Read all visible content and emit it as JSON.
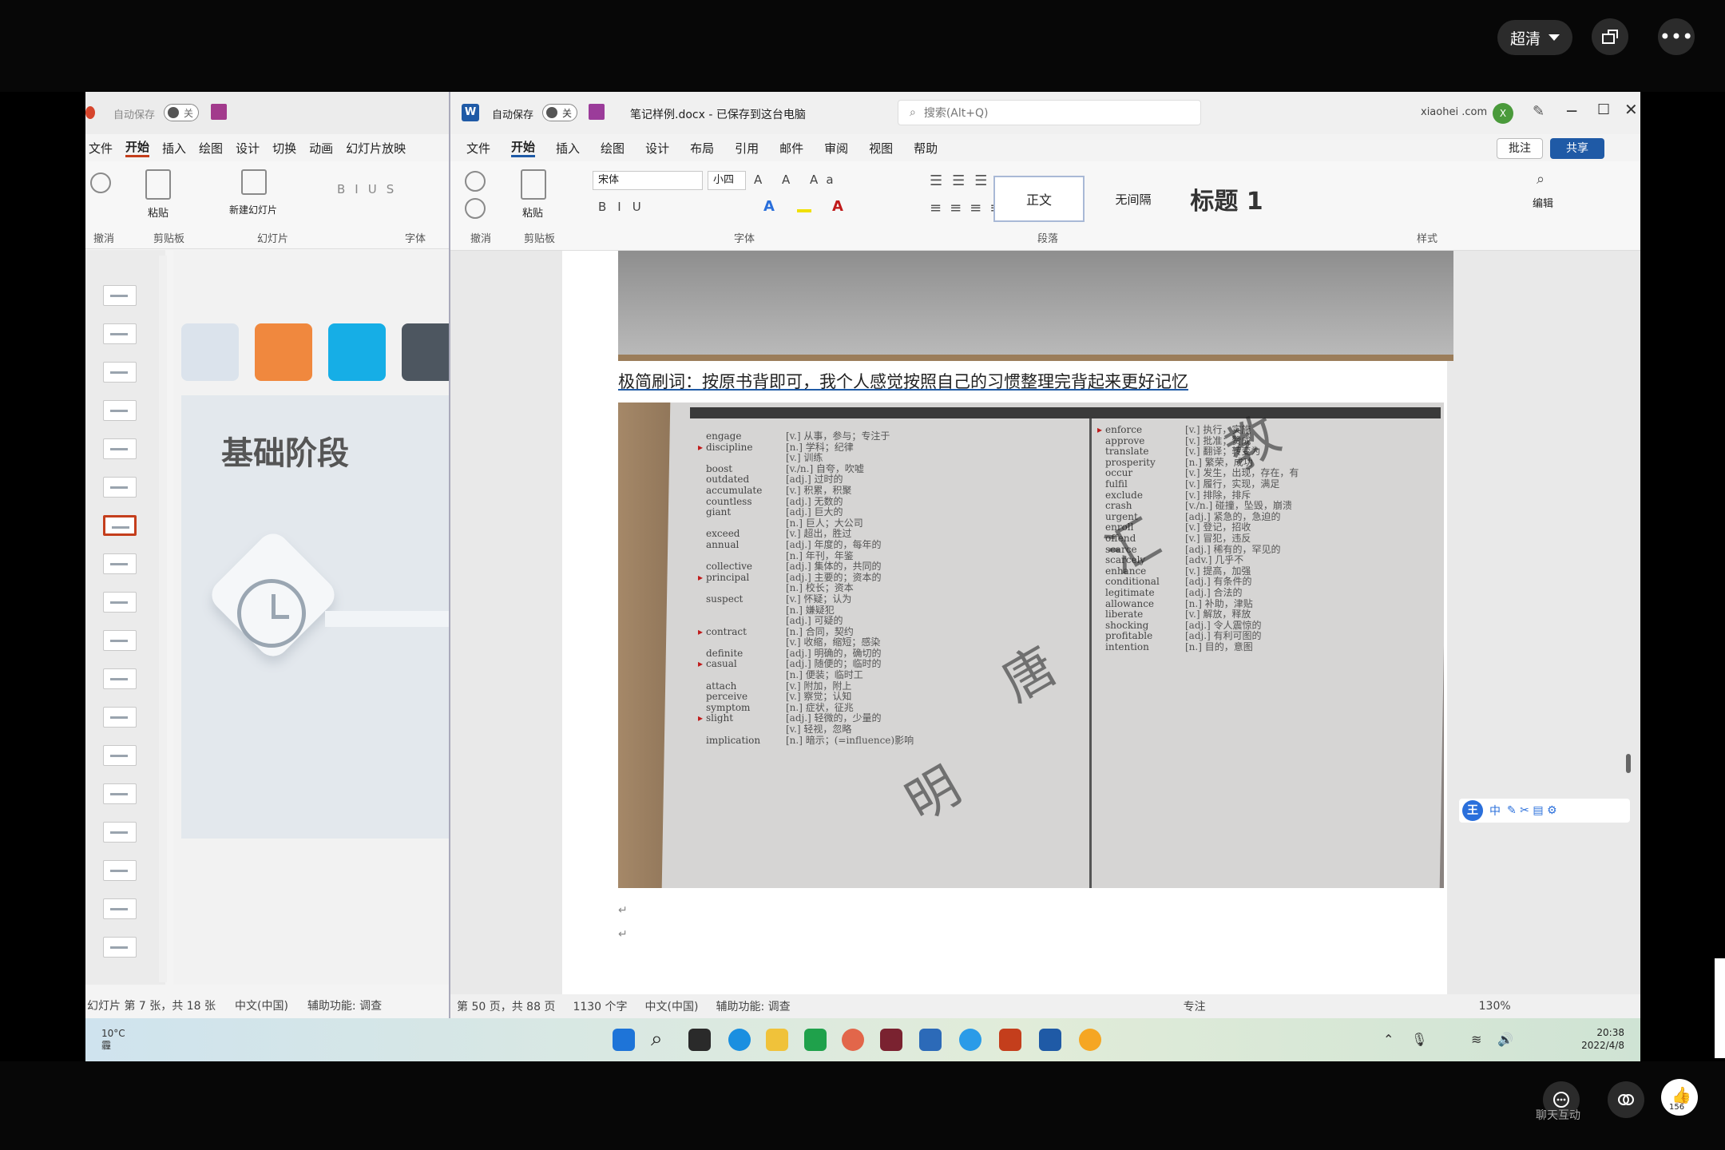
{
  "player": {
    "quality_label": "超清",
    "chat_label": "聊天互动",
    "like_count": "156"
  },
  "ppt": {
    "autosave_label": "自动保存",
    "autosave_state": "关",
    "menu": [
      "文件",
      "开始",
      "插入",
      "绘图",
      "设计",
      "切换",
      "动画",
      "幻灯片放映"
    ],
    "ribbon_groups": [
      "撤消",
      "剪贴板",
      "幻灯片",
      "字体"
    ],
    "paste_label": "粘贴",
    "new_slide_label": "新建幻灯片",
    "slide_title": "基础阶段",
    "status_slide": "幻灯片 第 7 张，共 18 张",
    "status_lang": "中文(中国)",
    "status_access": "辅助功能: 调查",
    "swatch_colors": [
      "#dbe3ec",
      "#f0883e",
      "#16aee6",
      "#4d5660"
    ]
  },
  "word": {
    "autosave_label": "自动保存",
    "autosave_state": "关",
    "doc_title": "笔记样例.docx - 已保存到这台电脑",
    "search_placeholder": "搜索(Alt+Q)",
    "account": "xiaohei .com",
    "account_initial": "X",
    "menu": [
      "文件",
      "开始",
      "插入",
      "绘图",
      "设计",
      "布局",
      "引用",
      "邮件",
      "审阅",
      "视图",
      "帮助"
    ],
    "comment_label": "批注",
    "share_label": "共享",
    "font_name": "宋体",
    "font_size": "小四",
    "ribbon_groups": [
      "撤消",
      "剪贴板",
      "字体",
      "段落",
      "样式"
    ],
    "paste_label": "粘贴",
    "styles": [
      "正文",
      "无间隔",
      "标题 1"
    ],
    "edit_label": "编辑",
    "doc_text": "极简刷词：按原书背即可，我个人感觉按照自己的习惯整理完背起来更好记忆",
    "status_page": "第 50 页，共 88 页",
    "status_words": "1130 个字",
    "status_lang": "中文(中国)",
    "status_access": "辅助功能: 调查",
    "status_focus": "专注",
    "zoom": "130%"
  },
  "vocab_left": [
    {
      "w": "engage",
      "d": "[v.] 从事，参与；专注于",
      "m": false
    },
    {
      "w": "discipline",
      "d": "[n.] 学科；纪律",
      "m": true
    },
    {
      "w": "",
      "d": "[v.] 训练",
      "m": false
    },
    {
      "w": "boost",
      "d": "[v./n.] 自夸，吹嘘",
      "m": false
    },
    {
      "w": "outdated",
      "d": "[adj.] 过时的",
      "m": false
    },
    {
      "w": "accumulate",
      "d": "[v.] 积累，积聚",
      "m": false
    },
    {
      "w": "countless",
      "d": "[adj.] 无数的",
      "m": false
    },
    {
      "w": "giant",
      "d": "[adj.] 巨大的",
      "m": false
    },
    {
      "w": "",
      "d": "[n.] 巨人；大公司",
      "m": false
    },
    {
      "w": "exceed",
      "d": "[v.] 超出，胜过",
      "m": false
    },
    {
      "w": "annual",
      "d": "[adj.] 年度的，每年的",
      "m": false
    },
    {
      "w": "",
      "d": "[n.] 年刊，年鉴",
      "m": false
    },
    {
      "w": "collective",
      "d": "[adj.] 集体的，共同的",
      "m": false
    },
    {
      "w": "principal",
      "d": "[adj.] 主要的；资本的",
      "m": true
    },
    {
      "w": "",
      "d": "[n.] 校长；资本",
      "m": false
    },
    {
      "w": "suspect",
      "d": "[v.] 怀疑；认为",
      "m": false
    },
    {
      "w": "",
      "d": "[n.] 嫌疑犯",
      "m": false
    },
    {
      "w": "",
      "d": "[adj.] 可疑的",
      "m": false
    },
    {
      "w": "contract",
      "d": "[n.] 合同，契约",
      "m": true
    },
    {
      "w": "",
      "d": "[v.] 收缩，缩短；感染",
      "m": false
    },
    {
      "w": "definite",
      "d": "[adj.] 明确的，确切的",
      "m": false
    },
    {
      "w": "casual",
      "d": "[adj.] 随便的；临时的",
      "m": true
    },
    {
      "w": "",
      "d": "[n.] 便装；临时工",
      "m": false
    },
    {
      "w": "attach",
      "d": "[v.] 附加，附上",
      "m": false
    },
    {
      "w": "perceive",
      "d": "[v.] 察觉；认知",
      "m": false
    },
    {
      "w": "symptom",
      "d": "[n.] 症状，征兆",
      "m": false
    },
    {
      "w": "slight",
      "d": "[adj.] 轻微的，少量的",
      "m": true
    },
    {
      "w": "",
      "d": "[v.] 轻视，忽略",
      "m": false
    },
    {
      "w": "implication",
      "d": "[n.] 暗示；(=influence)影响",
      "m": false
    }
  ],
  "vocab_right": [
    {
      "w": "enforce",
      "d": "[v.] 执行，实施",
      "m": true
    },
    {
      "w": "approve",
      "d": "[v.] 批准；赞成",
      "m": false
    },
    {
      "w": "translate",
      "d": "[v.] 翻译；转变为",
      "m": false
    },
    {
      "w": "prosperity",
      "d": "[n.] 繁荣，成功",
      "m": false
    },
    {
      "w": "occur",
      "d": "[v.] 发生，出现，存在，有",
      "m": false
    },
    {
      "w": "fulfil",
      "d": "[v.] 履行，实现，满足",
      "m": false
    },
    {
      "w": "exclude",
      "d": "[v.] 排除，排斥",
      "m": false
    },
    {
      "w": "crash",
      "d": "[v./n.] 碰撞，坠毁，崩溃",
      "m": false
    },
    {
      "w": "urgent",
      "d": "[adj.] 紧急的，急迫的",
      "m": false
    },
    {
      "w": "enroll",
      "d": "[v.] 登记，招收",
      "m": false
    },
    {
      "w": "offend",
      "d": "[v.] 冒犯，违反",
      "m": false
    },
    {
      "w": "scarce",
      "d": "[adj.] 稀有的，罕见的",
      "m": false
    },
    {
      "w": "scarcely",
      "d": "[adv.] 几乎不",
      "m": false
    },
    {
      "w": "enhance",
      "d": "[v.] 提高，加强",
      "m": false
    },
    {
      "w": "conditional",
      "d": "[adj.] 有条件的",
      "m": false
    },
    {
      "w": "legitimate",
      "d": "[adj.] 合法的",
      "m": false
    },
    {
      "w": "allowance",
      "d": "[n.] 补助，津贴",
      "m": false
    },
    {
      "w": "liberate",
      "d": "[v.] 解放，释放",
      "m": false
    },
    {
      "w": "shocking",
      "d": "[adj.] 令人震惊的",
      "m": false
    },
    {
      "w": "profitable",
      "d": "[adj.] 有利可图的",
      "m": false
    },
    {
      "w": "intention",
      "d": "[n.] 目的，意图",
      "m": false
    }
  ],
  "watermark": [
    "明",
    "唐",
    "汇",
    "教"
  ],
  "ime": {
    "logo": "王",
    "mode": "中"
  },
  "taskbar": {
    "temp": "10°C",
    "weather": "霾",
    "time": "20:38",
    "date": "2022/4/8"
  }
}
